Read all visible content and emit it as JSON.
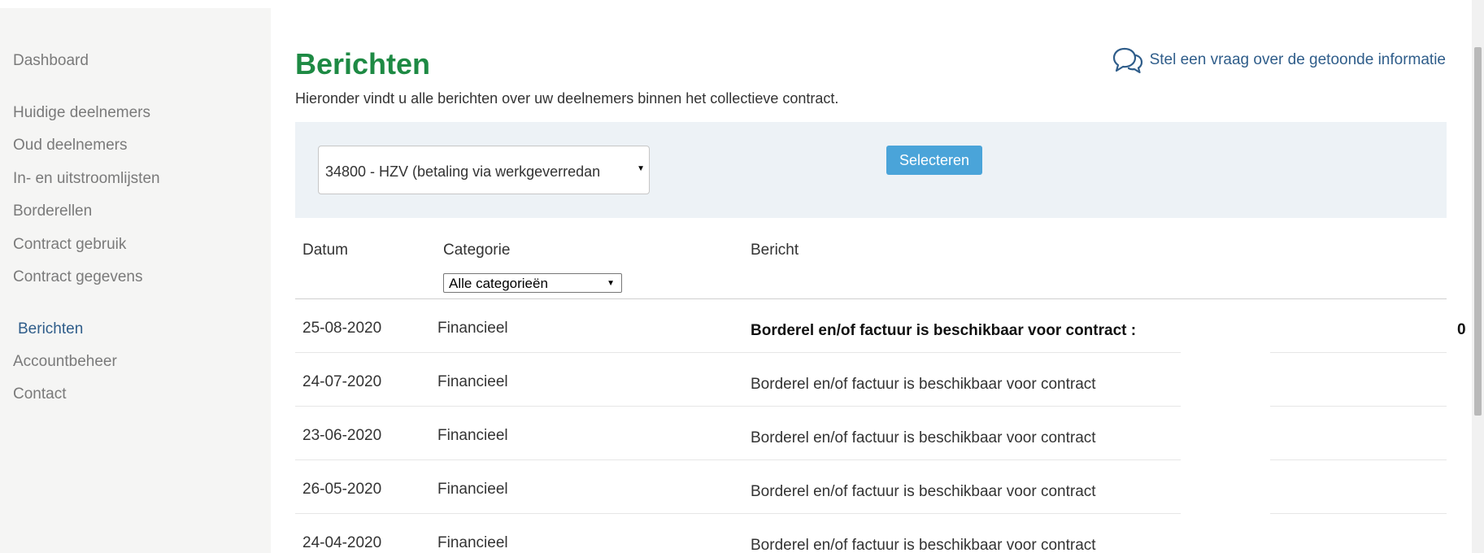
{
  "sidebar": {
    "items": [
      {
        "label": "Dashboard"
      },
      {
        "label": "Huidige deelnemers"
      },
      {
        "label": "Oud deelnemers"
      },
      {
        "label": "In- en uitstroomlijsten"
      },
      {
        "label": "Borderellen"
      },
      {
        "label": "Contract gebruik"
      },
      {
        "label": "Contract gegevens"
      },
      {
        "label": "Berichten"
      },
      {
        "label": "Accountbeheer"
      },
      {
        "label": "Contact"
      }
    ],
    "active": "Berichten"
  },
  "header": {
    "title": "Berichten",
    "intro": "Hieronder vindt u alle berichten over uw deelnemers binnen het collectieve contract.",
    "help_link": "Stel een vraag over de getoonde informatie",
    "help_icon": "speech-bubbles-icon"
  },
  "filter": {
    "contract_value": "34800 - HZV (betaling via werkgeverredan",
    "select_button": "Selecteren"
  },
  "table": {
    "headers": {
      "date": "Datum",
      "category": "Categorie",
      "message": "Bericht"
    },
    "category_filter": "Alle categorieën",
    "rows": [
      {
        "date": "25-08-2020",
        "category": "Financieel",
        "message": "Borderel en/of factuur is beschikbaar voor contract :",
        "message_tail": "0",
        "unread": true
      },
      {
        "date": "24-07-2020",
        "category": "Financieel",
        "message": "Borderel en/of factuur is beschikbaar voor contract",
        "unread": false
      },
      {
        "date": "23-06-2020",
        "category": "Financieel",
        "message": "Borderel en/of factuur is beschikbaar voor contract",
        "unread": false
      },
      {
        "date": "26-05-2020",
        "category": "Financieel",
        "message": "Borderel en/of factuur is beschikbaar voor contract",
        "unread": false
      },
      {
        "date": "24-04-2020",
        "category": "Financieel",
        "message": "Borderel en/of factuur is beschikbaar voor contract",
        "unread": false
      }
    ]
  },
  "colors": {
    "title_green": "#1e8a44",
    "link_blue": "#2f5d8a",
    "button_blue": "#4aa4d9",
    "panel_bg": "#edf2f6",
    "sidebar_bg": "#f5f5f4"
  }
}
